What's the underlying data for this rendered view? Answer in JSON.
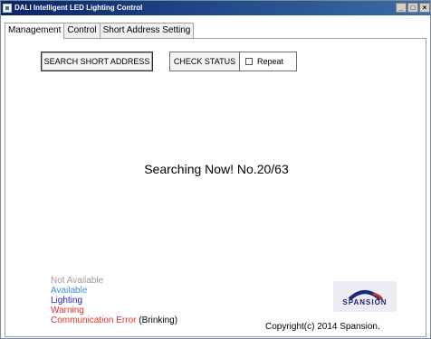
{
  "window": {
    "title": "DALI Intelligent LED Lighting Control",
    "minimize_label": "_",
    "maximize_label": "□",
    "close_label": "×"
  },
  "tabs": [
    {
      "label": "Management",
      "active": true
    },
    {
      "label": "Control",
      "active": false
    },
    {
      "label": "Short Address Setting",
      "active": false
    }
  ],
  "management": {
    "search_button": "SEARCH SHORT ADDRESS",
    "check_button": "CHECK STATUS",
    "repeat_label": "Repeat",
    "repeat_checked": false,
    "status_text": "Searching Now! No.20/63"
  },
  "legend": {
    "not_available": "Not Available",
    "available": "Available",
    "lighting": "Lighting",
    "warning": "Warning",
    "comm_error": "Communication Error",
    "comm_error_note": "(Brinking)"
  },
  "colors": {
    "not_available": "#9a9a9a",
    "available": "#3c8fdc",
    "lighting": "#2222cc",
    "warning": "#e0302a",
    "comm_error": "#e0302a",
    "titlebar": "#0a246a"
  },
  "logo": {
    "text": "SPANSION"
  },
  "copyright": "Copyright(c) 2014 Spansion."
}
